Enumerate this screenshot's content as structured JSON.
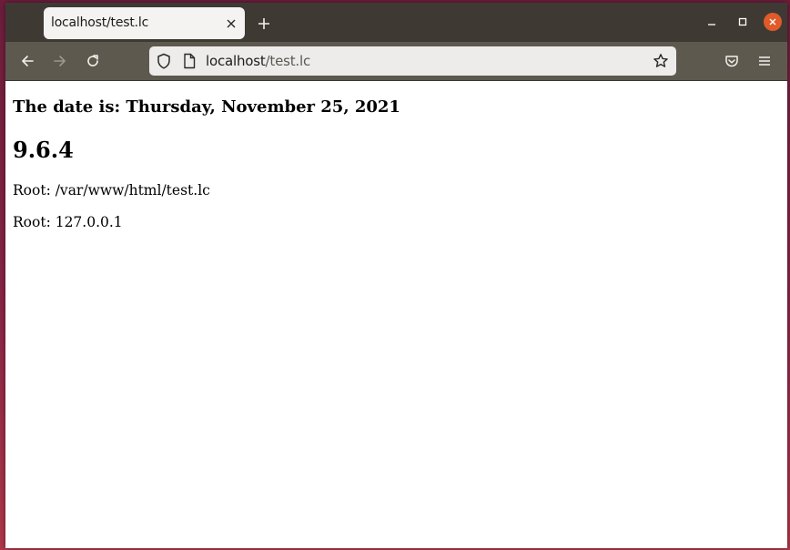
{
  "browser": {
    "tab": {
      "title": "localhost/test.lc"
    },
    "address": {
      "host": "localhost",
      "path": "/test.lc"
    }
  },
  "page": {
    "heading_date": "The date is: Thursday, November 25, 2021",
    "version": "9.6.4",
    "root_path": "Root: /var/www/html/test.lc",
    "root_ip": "Root: 127.0.0.1"
  },
  "icons": {
    "tab_close": "close-icon",
    "new_tab": "plus-icon",
    "back": "arrow-left-icon",
    "forward": "arrow-right-icon",
    "reload": "reload-icon",
    "shield": "shield-icon",
    "page": "page-icon",
    "bookmark": "star-icon",
    "pocket": "pocket-icon",
    "menu": "hamburger-menu-icon",
    "minimize": "minimize-icon",
    "maximize": "maximize-icon",
    "window_close": "window-close-icon"
  },
  "colors": {
    "tabbar": "#3e3a33",
    "navbar": "#5e594f",
    "urlbar": "#eeecea",
    "close_button": "#e05a2a"
  }
}
